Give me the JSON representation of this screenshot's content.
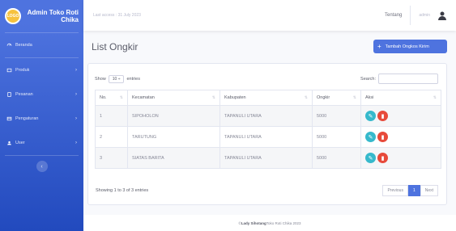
{
  "brand": {
    "logo_text": "LOGO",
    "title": "Admin Toko Roti Chika"
  },
  "sidebar": {
    "items": [
      {
        "label": "Beranda",
        "has_chevron": false
      },
      {
        "label": "Produk",
        "has_chevron": true
      },
      {
        "label": "Pesanan",
        "has_chevron": true
      },
      {
        "label": "Pengaturan",
        "has_chevron": true
      },
      {
        "label": "User",
        "has_chevron": true
      }
    ],
    "toggle_glyph": "‹",
    "chevron_glyph": "›"
  },
  "topbar": {
    "last_access": "Last access : 31 July 2023",
    "nav_link": "Tentang",
    "user_name": "admin",
    "user_icon": "user-icon"
  },
  "main": {
    "title": "List Ongkir",
    "add_button": {
      "icon": "+",
      "label": "Tambah Ongkos Kirim"
    },
    "show_label": "Show",
    "entries_value": "10 ÷",
    "entries_label": "entries",
    "search_label": "Search:",
    "search_value": "",
    "columns": [
      "No.",
      "Kecamatan",
      "Kabupaten",
      "Ongkir",
      "Aksi"
    ],
    "rows": [
      {
        "no": "1",
        "kecamatan": "SIPOHOLON",
        "kabupaten": "TAPANULI UTARA",
        "ongkir": "5000"
      },
      {
        "no": "2",
        "kecamatan": "TARUTUNG",
        "kabupaten": "TAPANULI UTARA",
        "ongkir": "5000"
      },
      {
        "no": "3",
        "kecamatan": "SIATAS BARITA",
        "kabupaten": "TAPANULI UTARA",
        "ongkir": "5000"
      }
    ],
    "info": "Showing 1 to 3 of 3 entries",
    "pagination": {
      "previous": "Previous",
      "current": "1",
      "next": "Next"
    }
  },
  "footer": {
    "copy": "© ",
    "author": "Lady Sihotang",
    "rest": " Toko Roti Chika 2023"
  },
  "colors": {
    "primary": "#4e73df",
    "info": "#36b9cc",
    "danger": "#e74a3b"
  }
}
